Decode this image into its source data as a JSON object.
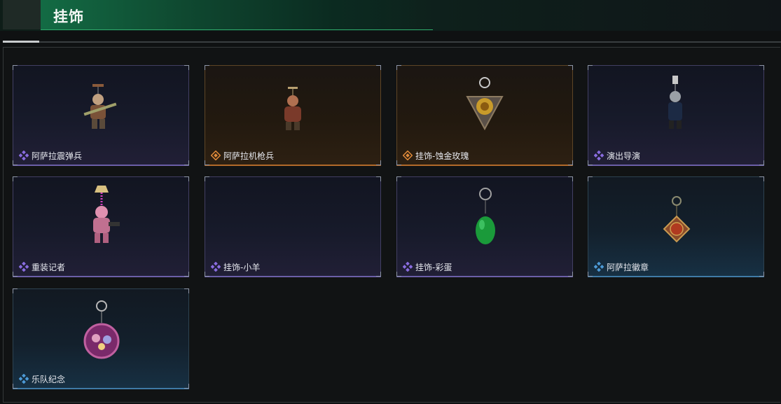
{
  "header": {
    "title": "挂饰"
  },
  "colors": {
    "accent_green": "#2fa86a",
    "purple": "#8a6de0",
    "orange": "#e08a3a",
    "blue": "#4d9ad6"
  },
  "items": [
    {
      "name": "阿萨拉震弹兵",
      "rarity": "purple",
      "icon": "soldier-charm-icon"
    },
    {
      "name": "阿萨拉机枪兵",
      "rarity": "orange",
      "icon": "gunner-charm-icon"
    },
    {
      "name": "挂饰-蚀金玫瑰",
      "rarity": "orange",
      "icon": "golden-rose-charm-icon"
    },
    {
      "name": "演出导演",
      "rarity": "purple",
      "icon": "director-charm-icon"
    },
    {
      "name": "重装记者",
      "rarity": "purple",
      "icon": "reporter-charm-icon"
    },
    {
      "name": "挂饰-小羊",
      "rarity": "purple",
      "icon": "lamb-charm-icon"
    },
    {
      "name": "挂饰-彩蛋",
      "rarity": "purple",
      "icon": "easter-egg-charm-icon"
    },
    {
      "name": "阿萨拉徽章",
      "rarity": "blue",
      "icon": "asala-badge-charm-icon"
    },
    {
      "name": "乐队纪念",
      "rarity": "blue",
      "icon": "band-badge-charm-icon"
    }
  ]
}
